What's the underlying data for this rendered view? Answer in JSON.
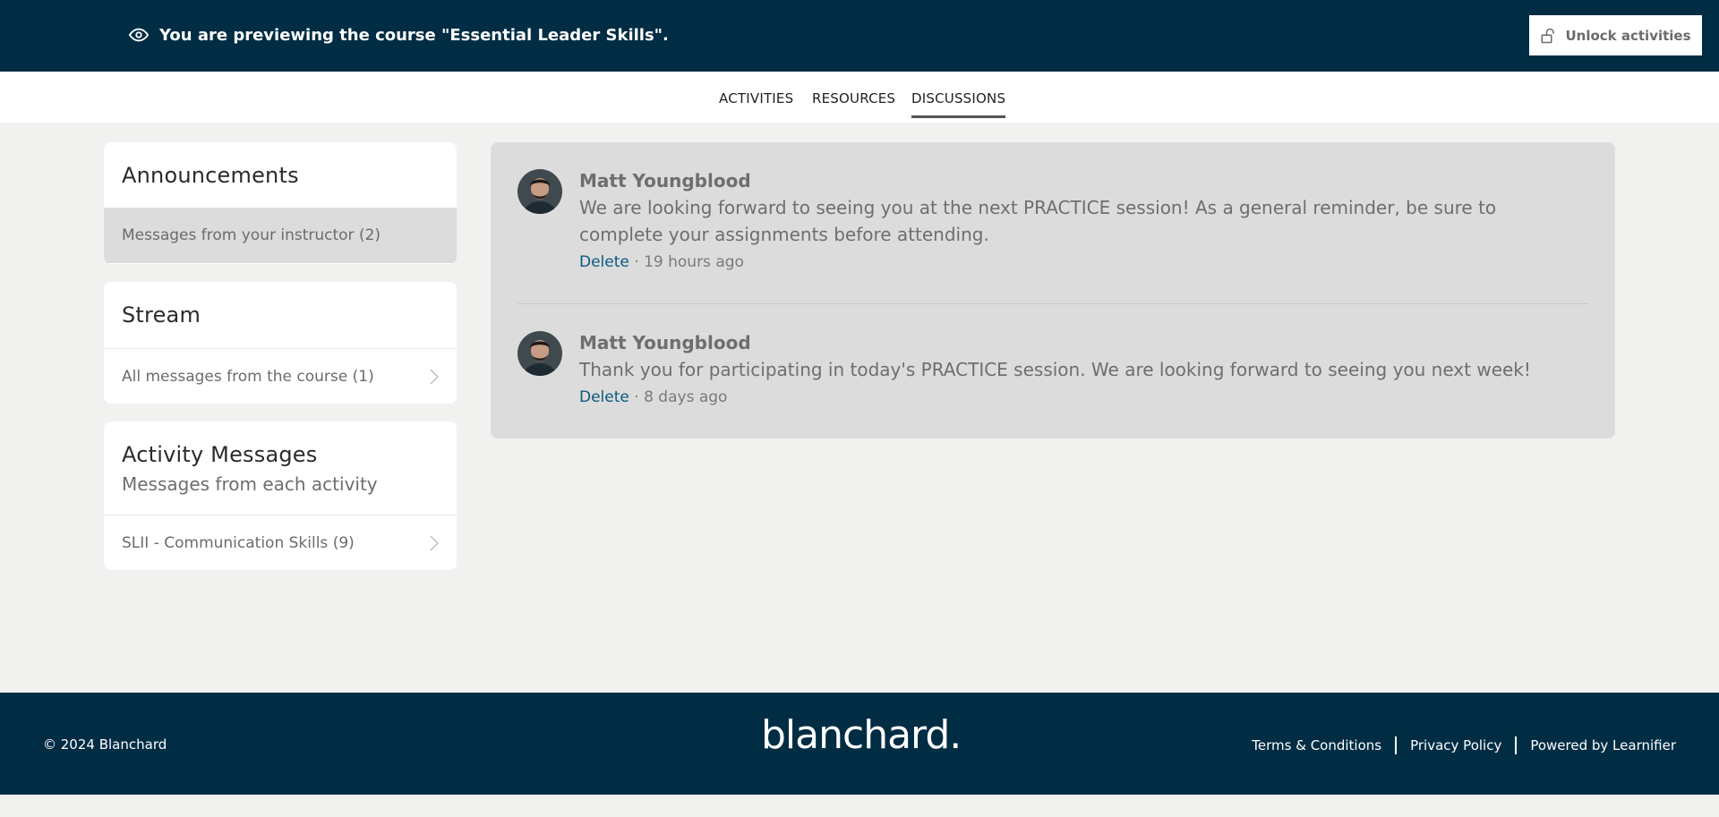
{
  "preview": {
    "message": "You are previewing the course \"Essential Leader Skills\".",
    "icon": "eye-icon",
    "unlock_label": "Unlock activities",
    "unlock_icon": "unlock-icon"
  },
  "tabs": [
    {
      "label": "ACTIVITIES",
      "active": false
    },
    {
      "label": "RESOURCES",
      "active": false
    },
    {
      "label": "DISCUSSIONS",
      "active": true
    }
  ],
  "sidebar": {
    "announcements": {
      "title": "Announcements",
      "item": "Messages from your instructor (2)"
    },
    "stream": {
      "title": "Stream",
      "item": "All messages from the course (1)"
    },
    "activity": {
      "title": "Activity Messages",
      "subtitle": "Messages from each activity",
      "item": "SLII - Communication Skills (9)"
    }
  },
  "posts": [
    {
      "author": "Matt Youngblood",
      "message": "We are looking forward to seeing you at the next PRACTICE session! As a general reminder, be sure to complete your assignments before attending.",
      "delete_label": "Delete",
      "time": "19 hours ago"
    },
    {
      "author": "Matt Youngblood",
      "message": "Thank you for participating in today's PRACTICE session. We are looking forward to seeing you next week!",
      "delete_label": "Delete",
      "time": "8 days ago"
    }
  ],
  "footer": {
    "copyright": "© 2024 Blanchard",
    "brand": "blanchard.",
    "links": [
      "Terms & Conditions",
      "Privacy Policy",
      "Powered by Learnifier"
    ]
  },
  "colors": {
    "header_bg": "#002d44",
    "page_bg": "#f1f1f0",
    "panel_bg": "#dcdcdc",
    "link": "#0a5a7e"
  }
}
